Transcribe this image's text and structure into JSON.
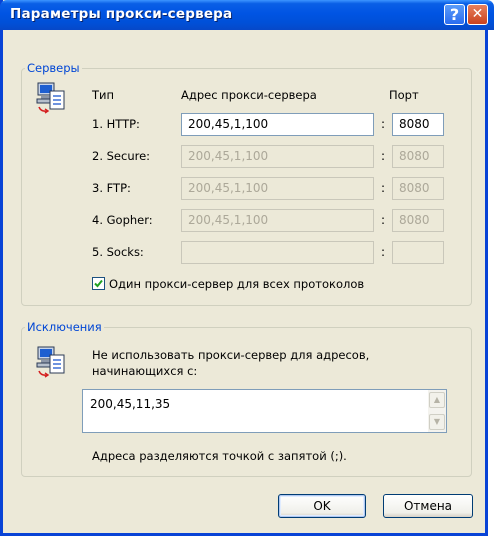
{
  "window": {
    "title": "Параметры прокси-сервера"
  },
  "servers": {
    "legend": "Серверы",
    "col_type": "Тип",
    "col_address": "Адрес прокси-сервера",
    "col_port": "Порт",
    "rows": [
      {
        "type": "1. HTTP:",
        "address": "200,45,1,100",
        "port": "8080",
        "enabled": true
      },
      {
        "type": "2. Secure:",
        "address": "200,45,1,100",
        "port": "8080",
        "enabled": false
      },
      {
        "type": "3. FTP:",
        "address": "200,45,1,100",
        "port": "8080",
        "enabled": false
      },
      {
        "type": "4. Gopher:",
        "address": "200,45,1,100",
        "port": "8080",
        "enabled": false
      },
      {
        "type": "5. Socks:",
        "address": "",
        "port": "",
        "enabled": false
      }
    ],
    "separator": ":",
    "same_proxy_label": "Один прокси-сервер для всех протоколов",
    "same_proxy_checked": true
  },
  "exceptions": {
    "legend": "Исключения",
    "description": "Не использовать прокси-сервер для адресов, начинающихся с:",
    "description_line1": "Не использовать прокси-сервер для адресов,",
    "description_line2": "начинающихся с:",
    "value": "200,45,11,35",
    "hint": "Адреса разделяются точкой с запятой (;)."
  },
  "buttons": {
    "ok": "OK",
    "cancel": "Отмена"
  },
  "icons": [
    "computer-network-icon",
    "help-icon",
    "close-icon",
    "checkmark-icon",
    "scroll-up-icon",
    "scroll-down-icon"
  ],
  "colors": {
    "titlebar": "#0054e3",
    "dialog_bg": "#ece9d8",
    "legend_text": "#0046d5",
    "field_border": "#7f9db9"
  }
}
